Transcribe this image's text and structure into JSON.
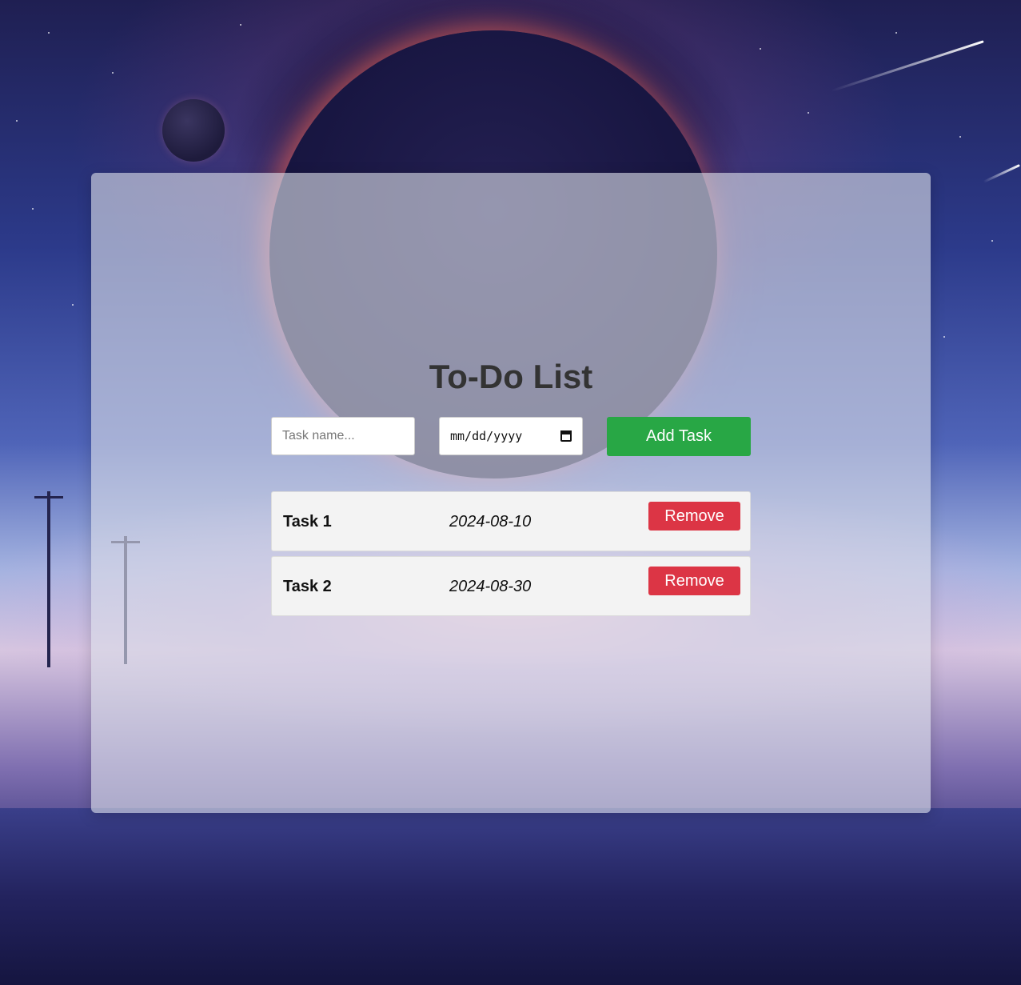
{
  "app": {
    "title": "To-Do List"
  },
  "form": {
    "task_placeholder": "Task name...",
    "task_value": "",
    "date_placeholder": "mm/dd/yyyy",
    "add_label": "Add Task"
  },
  "tasks": [
    {
      "name": "Task 1",
      "date": "2024-08-10",
      "remove_label": "Remove"
    },
    {
      "name": "Task 2",
      "date": "2024-08-30",
      "remove_label": "Remove"
    }
  ],
  "colors": {
    "add_button": "#28a745",
    "remove_button": "#dc3545",
    "title": "#333333"
  },
  "icons": {
    "date_picker": "calendar-icon"
  }
}
